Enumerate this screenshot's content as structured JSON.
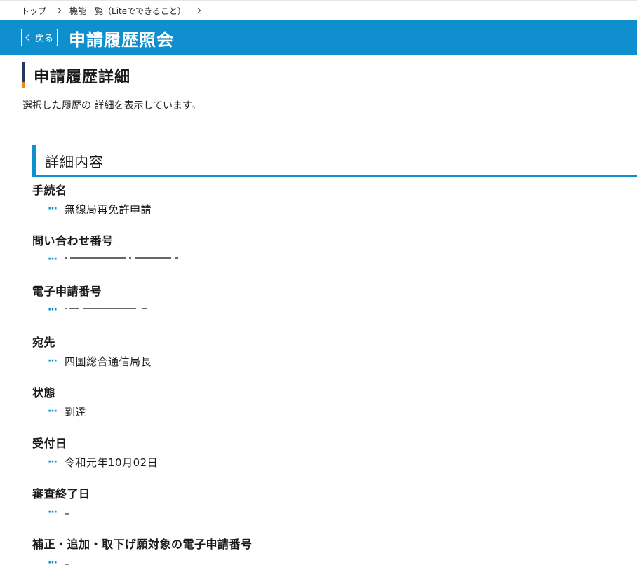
{
  "breadcrumb": {
    "items": [
      "トップ",
      "機能一覧（Liteでできること）"
    ]
  },
  "header": {
    "back_label": "戻る",
    "title": "申請履歴照会"
  },
  "page": {
    "heading": "申請履歴詳細",
    "description": "選択した履歴の 詳細を表示しています。"
  },
  "section": {
    "title": "詳細内容"
  },
  "fields": [
    {
      "label": "手続名",
      "value": "無線局再免許申請"
    },
    {
      "label": "問い合わせ番号",
      "value": ""
    },
    {
      "label": "電子申請番号",
      "value": ""
    },
    {
      "label": "宛先",
      "value": "四国総合通信局長"
    },
    {
      "label": "状態",
      "value": "到達"
    },
    {
      "label": "受付日",
      "value": "令和元年10月02日"
    },
    {
      "label": "審査終了日",
      "value": "–"
    },
    {
      "label": "補正・追加・取下げ願対象の電子申請番号",
      "value": "–"
    }
  ],
  "colors": {
    "accent": "#0f8fce",
    "heading_bar": "#233a5e",
    "heading_bar_accent": "#e88a1a"
  }
}
